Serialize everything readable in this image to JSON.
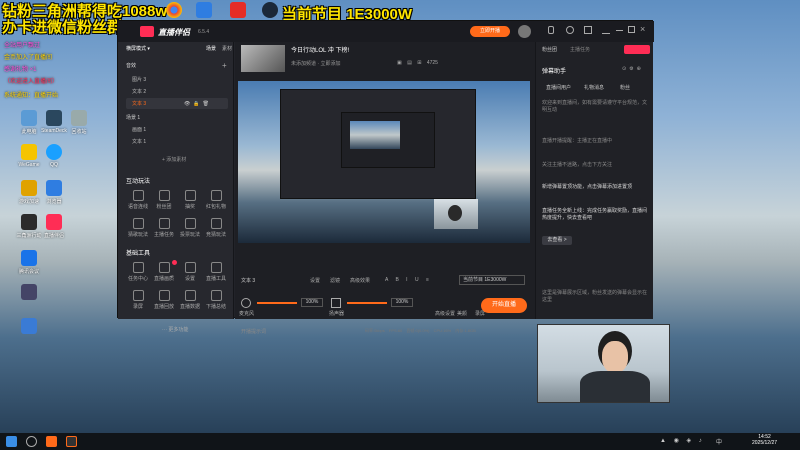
{
  "stream_overlay": {
    "line1": "钻粉三角洲帮得吃1088w",
    "line2": "办卡进微信粉丝群",
    "line3": "当前节目 1E3000W"
  },
  "chat_lines": [
    "全站用户飘过",
    "金币加入了直播间",
    "感谢礼物 ×1",
    "（欢迎进入直播间）",
    "系统通知：直播开始"
  ],
  "desktop_icons": [
    {
      "label": "此电脑",
      "color": "#5b9bd5"
    },
    {
      "label": "SteamDeck",
      "color": "#2a475e"
    },
    {
      "label": "回收站",
      "color": "#9aa"
    },
    {
      "label": "WeGame",
      "color": "#f5c400"
    },
    {
      "label": "QQ",
      "color": "#1aa0ff"
    },
    {
      "label": "游戏加速",
      "color": "#e0a200"
    },
    {
      "label": "直播伴侣",
      "color": "#ff2d55"
    },
    {
      "label": "浏览器",
      "color": "#2f7de1"
    },
    {
      "label": "三角洲行动",
      "color": "#2b2b2b"
    },
    {
      "label": "腾讯会议",
      "color": "#1a73e8"
    }
  ],
  "app": {
    "logo": "直播伴侣",
    "version": "6.5.4",
    "stream_title": "今日行动LOL 冲 下榜!",
    "subtitle": "未添加频道 · 立即添加",
    "start_btn": "立即开播",
    "fans": "4725",
    "left": {
      "mode_label": "横屏模式",
      "tab_scene": "场景",
      "tab_source": "素材",
      "tab_sound": "音效",
      "scenes": [
        "图片 3",
        "文本 2",
        "文本 3"
      ],
      "scene2_label": "场景 1",
      "scene2_items": [
        "画面 1",
        "文本 1"
      ],
      "add_source": "+ 添加素材",
      "interaction_title": "互动玩法",
      "interaction_items": [
        "语音连线",
        "粉丝团",
        "抽奖",
        "红包礼物",
        "猜歌玩法",
        "主播任务",
        "投票玩法",
        "竞猜玩法"
      ],
      "tools_title": "基础工具",
      "tools_items": [
        "任务中心",
        "直播画质",
        "设置",
        "直播工具",
        "录屏",
        "直播回放",
        "直播数据",
        "下播总结"
      ],
      "more": "··· 更多功能"
    },
    "center": {
      "source_label": "文本 3",
      "toolbar": [
        "设置",
        "滤镜",
        "高级效果"
      ],
      "live_item": "当前节目 1E3000W",
      "mic_label": "麦克风",
      "mic_vol": "100%",
      "speaker_label": "扬声器",
      "speaker_vol": "100%",
      "buttons": [
        "高级设置",
        "美颜",
        "录屏"
      ],
      "start_live": "开始直播",
      "status": [
        "码率:0kbps",
        "FPS:60",
        "丢帧:0(0.0%)",
        "CPU:16%",
        "内存:1.8GB"
      ],
      "bottom_left": "开播提示词"
    },
    "right": {
      "tabs": [
        "粉丝团",
        "主播任务"
      ],
      "helper_title": "弹幕助手",
      "subtabs": [
        "直播间用户",
        "礼物消息",
        "粉丝"
      ],
      "msgs": [
        "欢迎来到直播间，如有需要请遵守平台规范，文明互动",
        "直播开播提醒：主播正在直播中",
        "关注主播不迷路，点击下方关注"
      ],
      "hl1": "新增弹幕置顶功能，点击弹幕添加进置顶",
      "hl2": "直播任务全新上线：完成任务赢取奖励，直播间热度提升，快去查看吧",
      "view_btn": "去查看 >",
      "tail": "这里是弹幕展示区域，粉丝发送的弹幕会显示在这里"
    }
  },
  "taskbar": {
    "time": "14:52",
    "date": "2025/12/27",
    "lang": "中"
  }
}
